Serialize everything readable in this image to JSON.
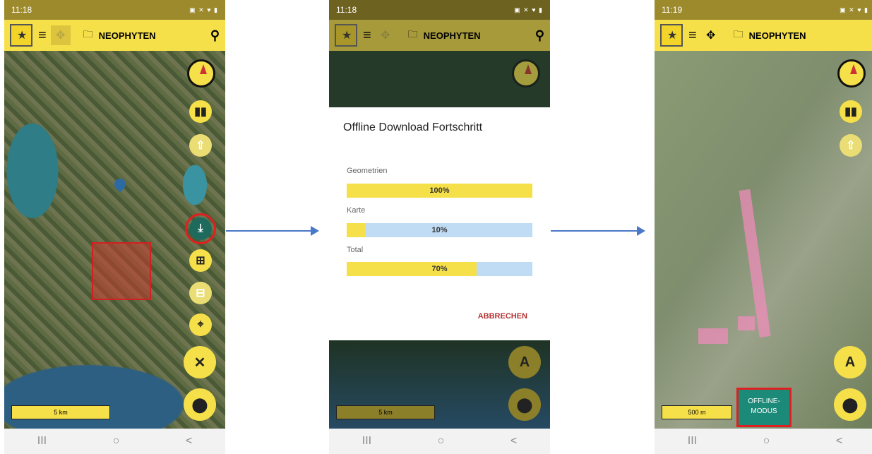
{
  "panel1": {
    "time": "11:18",
    "status_icons": "⚙ ▣ ⬤ ··",
    "status_right": "▣ ✕ ♥ ▮",
    "app_title": "NEOPHYTEN",
    "scale_label": "5 km"
  },
  "panel2": {
    "time": "11:18",
    "status_icons": "▣ ⬤ ⬤ ··",
    "status_right": "▣ ✕ ♥ ▮",
    "app_title": "NEOPHYTEN",
    "dialog_title": "Offline Download Fortschritt",
    "progress": [
      {
        "label": "Geometrien",
        "percent_text": "100%",
        "fraction": 1.0
      },
      {
        "label": "Karte",
        "percent_text": "10%",
        "fraction": 0.1
      },
      {
        "label": "Total",
        "percent_text": "70%",
        "fraction": 0.7
      }
    ],
    "cancel_label": "ABBRECHEN",
    "scale_label": "5 km"
  },
  "panel3": {
    "time": "11:19",
    "status_icons": "▣ ⬤ ⬤ ··",
    "status_right": "▣ ✕ ♥ ▮",
    "app_title": "NEOPHYTEN",
    "scale_label": "500 m",
    "offline_line1": "OFFLINE-",
    "offline_line2": "MODUS"
  },
  "nav": {
    "recents": "III",
    "home": "○",
    "back": "<"
  },
  "icons": {
    "menu": "≡",
    "move": "✥",
    "folder": "🗀",
    "search": "⚲",
    "map": "▮▮",
    "up": "⇧",
    "download": "⤓",
    "zoom_in": "⊞",
    "zoom_out": "⊟",
    "locate": "⌖",
    "close": "✕",
    "pin": "⬤",
    "antenna": "A"
  },
  "colors": {
    "accent": "#f6e04a",
    "offline_bg": "#1c8a78",
    "cancel": "#b23333",
    "highlight": "#e02020",
    "arrow": "#4a78c8"
  }
}
